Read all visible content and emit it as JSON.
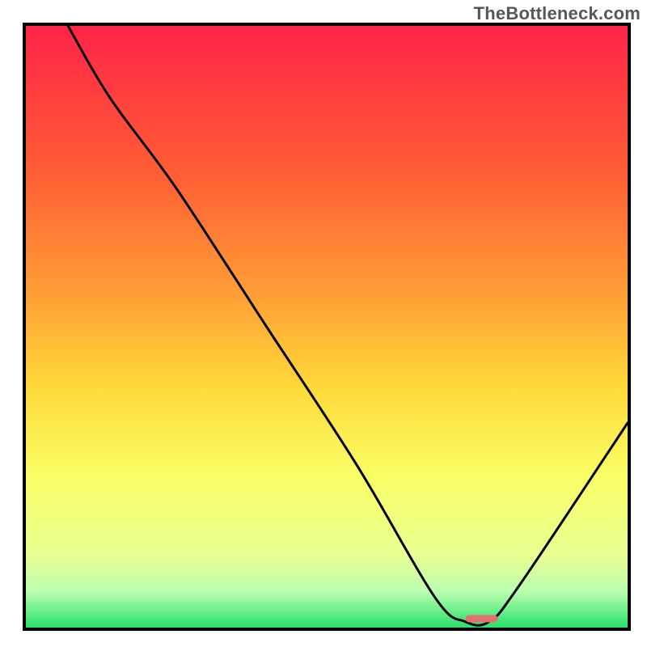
{
  "watermark": "TheBottleneck.com",
  "colors": {
    "top": "#ff2448",
    "mid_upper": "#ff8a2b",
    "mid": "#ffd93a",
    "mid_lower": "#f9ff66",
    "low": "#d8ffb0",
    "bottom": "#27e06a",
    "curve": "#000000",
    "marker": "#e2716f",
    "border": "#000000"
  },
  "chart_data": {
    "type": "line",
    "title": "",
    "xlabel": "",
    "ylabel": "",
    "xlim": [
      0,
      100
    ],
    "ylim": [
      0,
      100
    ],
    "background_gradient": {
      "direction": "vertical-top-to-bottom",
      "stops": [
        {
          "pos": 0.0,
          "color": "#ff2448"
        },
        {
          "pos": 0.25,
          "color": "#ff5f34"
        },
        {
          "pos": 0.45,
          "color": "#ffa036"
        },
        {
          "pos": 0.6,
          "color": "#ffd93a"
        },
        {
          "pos": 0.75,
          "color": "#f9ff66"
        },
        {
          "pos": 0.88,
          "color": "#e9ff93"
        },
        {
          "pos": 0.94,
          "color": "#baffb0"
        },
        {
          "pos": 1.0,
          "color": "#27e06a"
        }
      ]
    },
    "series": [
      {
        "name": "bottleneck-curve",
        "x": [
          7.0,
          14.0,
          25.0,
          40.0,
          55.0,
          68.0,
          73.0,
          77.0,
          82.0,
          100.0
        ],
        "y": [
          100.0,
          88.0,
          73.0,
          50.0,
          27.0,
          5.0,
          1.0,
          1.0,
          7.0,
          34.0
        ]
      }
    ],
    "marker": {
      "x_start": 73.0,
      "x_end": 78.5,
      "y": 1.5
    }
  }
}
